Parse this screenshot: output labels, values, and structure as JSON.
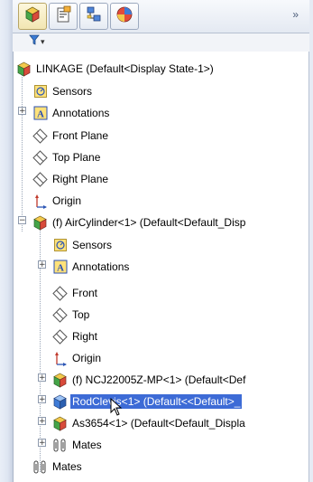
{
  "toolbar": {
    "tabs": [
      {
        "name": "featuremanager-tab-icon",
        "active": true
      },
      {
        "name": "propertymanager-tab-icon",
        "active": false
      },
      {
        "name": "configurationmanager-tab-icon",
        "active": false
      },
      {
        "name": "display-manager-tab-icon",
        "active": false
      }
    ],
    "more": "»"
  },
  "filter": {
    "icon": "filter-icon",
    "dropdown": "▾"
  },
  "tree": {
    "root": "LINKAGE  (Default<Display State-1>)",
    "sensors": "Sensors",
    "annotations": "Annotations",
    "front_plane": "Front Plane",
    "top_plane": "Top Plane",
    "right_plane": "Right Plane",
    "origin": "Origin",
    "aircylinder": "(f) AirCylinder<1> (Default<Default_Disp",
    "sub_sensors": "Sensors",
    "sub_annotations": "Annotations",
    "sub_front": "Front",
    "sub_top": "Top",
    "sub_right": "Right",
    "sub_origin": "Origin",
    "ncj": "(f) NCJ22005Z-MP<1> (Default<Def",
    "rodclevis": "RodClevis<1> (Default<<Default>_",
    "as3654": "As3654<1> (Default<Default_Displa",
    "sub_mates": "Mates",
    "mates": "Mates"
  },
  "colors": {
    "selection": "#3d6bd6",
    "annotation_icon": "#2a4fb0",
    "sensor_icon": "#e0a800"
  }
}
